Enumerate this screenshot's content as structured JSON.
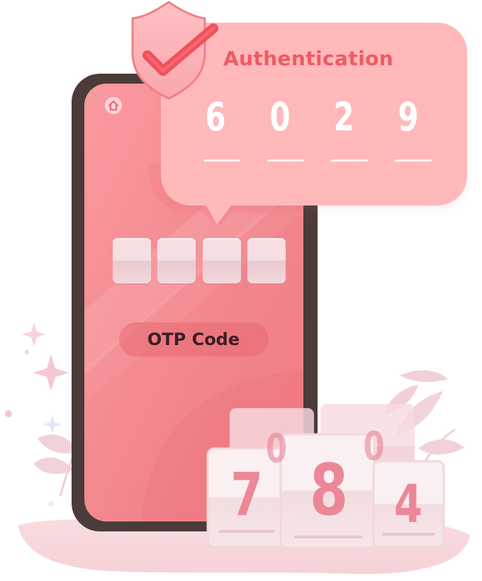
{
  "card": {
    "title": "Authentication",
    "digits": [
      "6",
      "0",
      "2",
      "9"
    ]
  },
  "phone": {
    "icon": "home-icon",
    "field_label": "OTP Code",
    "slots": [
      "",
      "",
      "",
      ""
    ]
  },
  "cards": {
    "front": [
      "7",
      "8",
      "4"
    ],
    "back": [
      "0",
      "0"
    ]
  },
  "icons": {
    "shield": "shield-check-icon",
    "sparkle": "sparkle-icon",
    "leaf": "leaf-icon"
  },
  "colors": {
    "accent": "#f05a63",
    "phone_screen": "#f27f86",
    "phone_frame": "#4b3b39",
    "card": "#ffb9bb",
    "slot": "#f4d8dc",
    "digit_text": "#ffffff",
    "otp_text": "#3b1f24",
    "background_blob": "#f7d1d5"
  }
}
